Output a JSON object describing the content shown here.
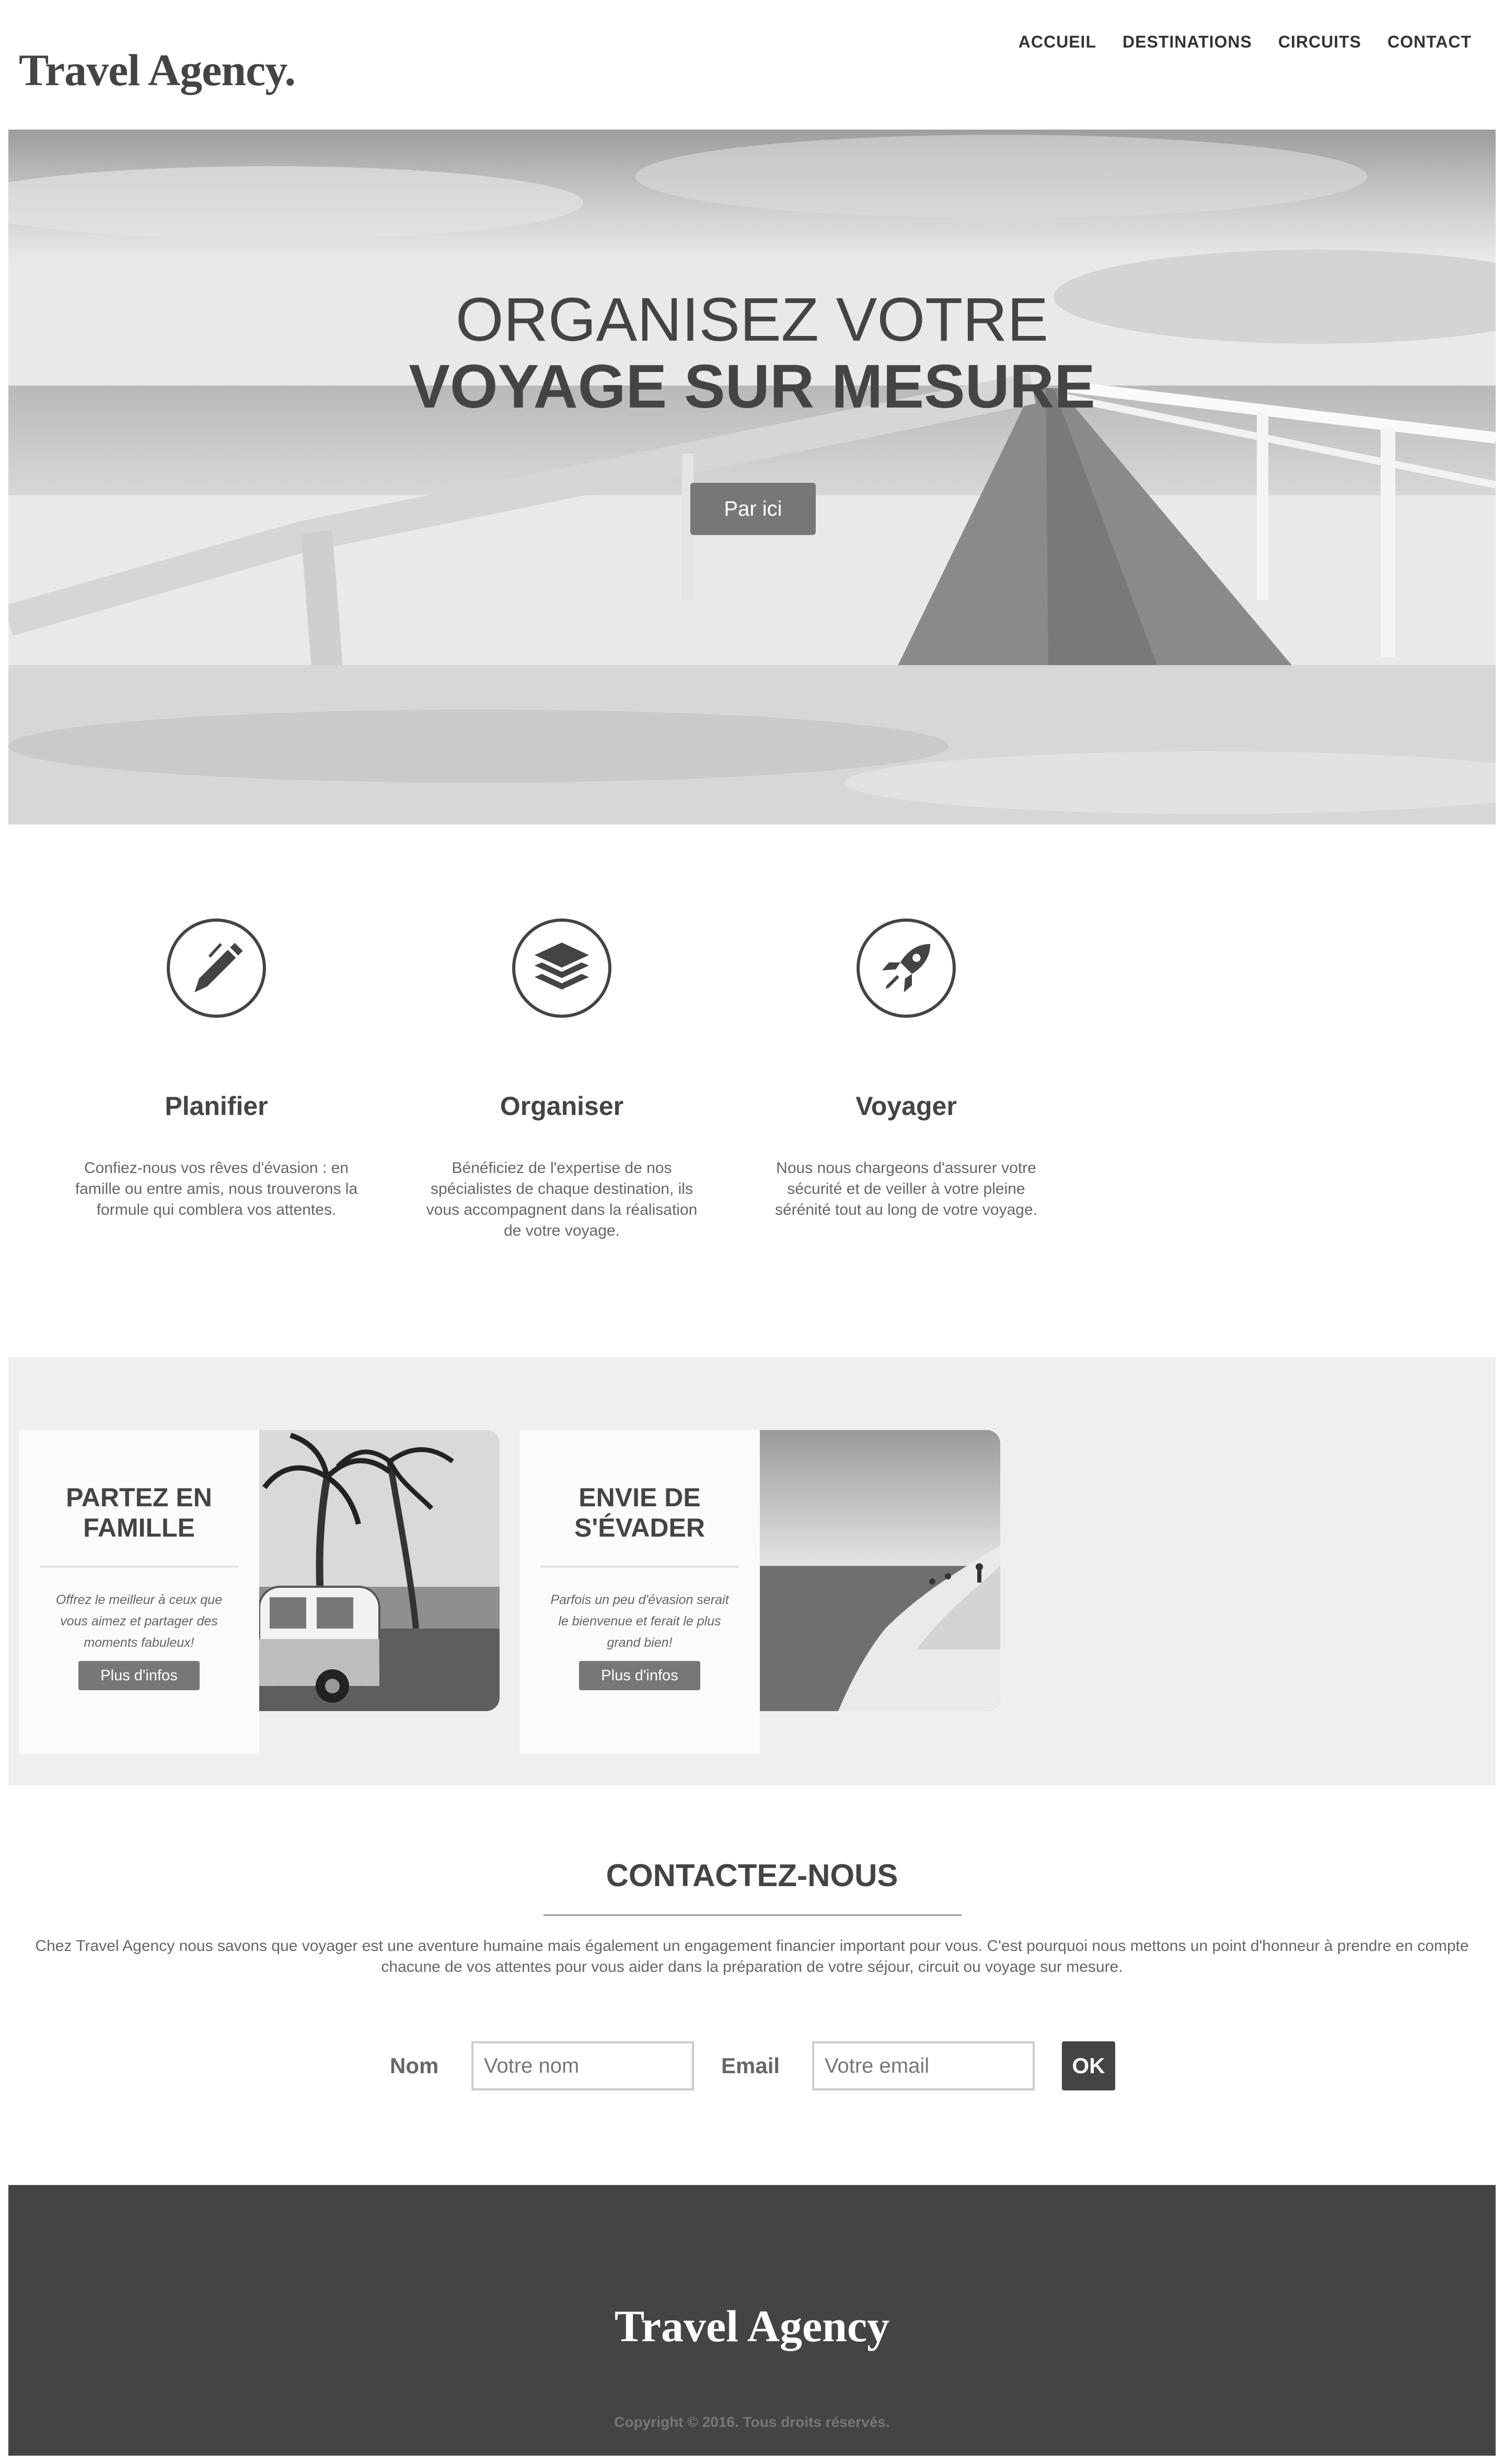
{
  "header": {
    "logo": "Travel Agency.",
    "nav": [
      "ACCUEIL",
      "DESTINATIONS",
      "CIRCUITS",
      "CONTACT"
    ]
  },
  "hero": {
    "line1": "ORGANISEZ VOTRE",
    "line2": "VOYAGE SUR MESURE",
    "button": "Par ici"
  },
  "features": [
    {
      "icon": "pen-icon",
      "title": "Planifier",
      "text": "Confiez-nous vos rêves d'évasion : en famille ou entre amis, nous trouverons la formule qui comblera vos attentes."
    },
    {
      "icon": "layers-icon",
      "title": "Organiser",
      "text": "Bénéficiez de l'expertise de nos spécialistes de chaque destination, ils vous accompagnent dans la réalisation de votre voyage."
    },
    {
      "icon": "rocket-icon",
      "title": "Voyager",
      "text": "Nous nous chargeons d'assurer votre sécurité et de veiller à votre pleine sérénité tout au long de votre voyage."
    }
  ],
  "cards": [
    {
      "title": "PARTEZ EN FAMILLE",
      "text": "Offrez le meilleur à ceux que vous aimez et partager des moments fabuleux!",
      "button": "Plus d'infos"
    },
    {
      "title": "ENVIE DE S'ÉVADER",
      "text": "Parfois un peu d'évasion serait le bienvenue et ferait le plus grand bien!",
      "button": "Plus d'infos"
    }
  ],
  "contact": {
    "title": "CONTACTEZ-NOUS",
    "text": "Chez Travel Agency nous savons que voyager est une aventure humaine mais également un engagement financier important pour vous. C'est pourquoi nous mettons un point d'honneur à prendre en compte chacune de vos attentes pour vous aider dans la préparation de votre séjour, circuit ou voyage sur mesure.",
    "name_label": "Nom",
    "name_placeholder": "Votre nom",
    "email_label": "Email",
    "email_placeholder": "Votre email",
    "submit": "OK"
  },
  "footer": {
    "logo": "Travel Agency",
    "copyright": "Copyright © 2016. Tous droits réservés."
  }
}
